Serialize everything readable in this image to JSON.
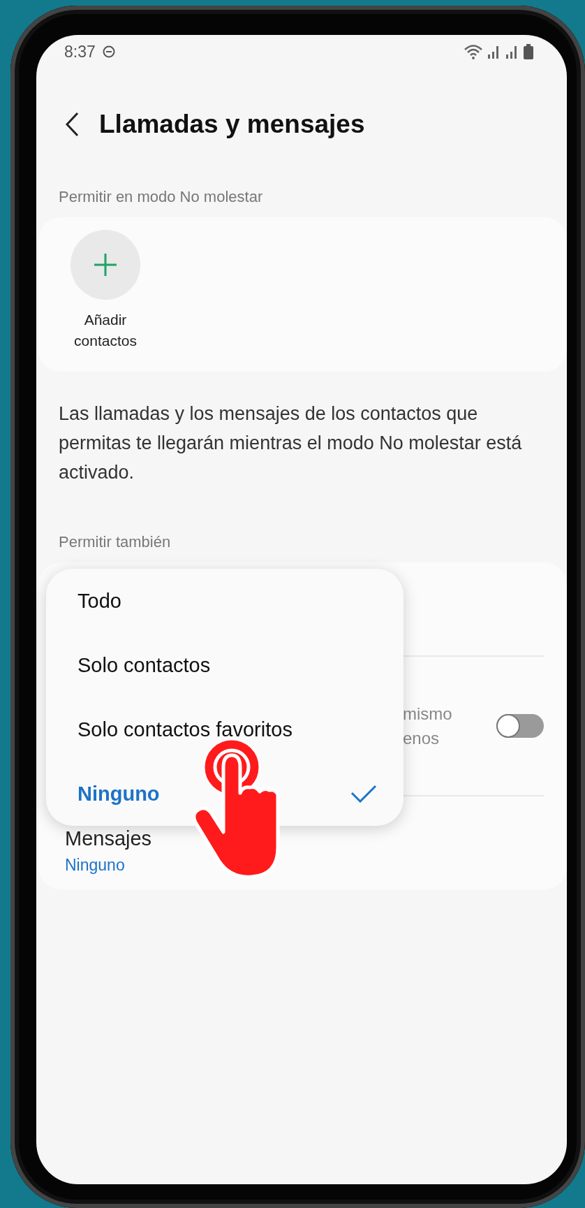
{
  "status_bar": {
    "time": "8:37"
  },
  "header": {
    "title": "Llamadas y mensajes"
  },
  "dnd_section": {
    "label": "Permitir en modo No molestar",
    "add_button": "Añadir contactos",
    "description": "Las llamadas y los mensajes de los contactos que permitas te llegarán mientras el modo No molestar está activado."
  },
  "also_section": {
    "label": "Permitir también",
    "rows": [
      {
        "kind": "blank"
      },
      {
        "kind": "toggle",
        "lines": [
          "mismo",
          "enos"
        ],
        "on": false
      },
      {
        "kind": "value",
        "title": "Mensajes",
        "value": "Ninguno"
      }
    ]
  },
  "menu": {
    "items": [
      {
        "label": "Todo",
        "selected": false
      },
      {
        "label": "Solo contactos",
        "selected": false
      },
      {
        "label": "Solo contactos favoritos",
        "selected": false
      },
      {
        "label": "Ninguno",
        "selected": true
      }
    ]
  }
}
